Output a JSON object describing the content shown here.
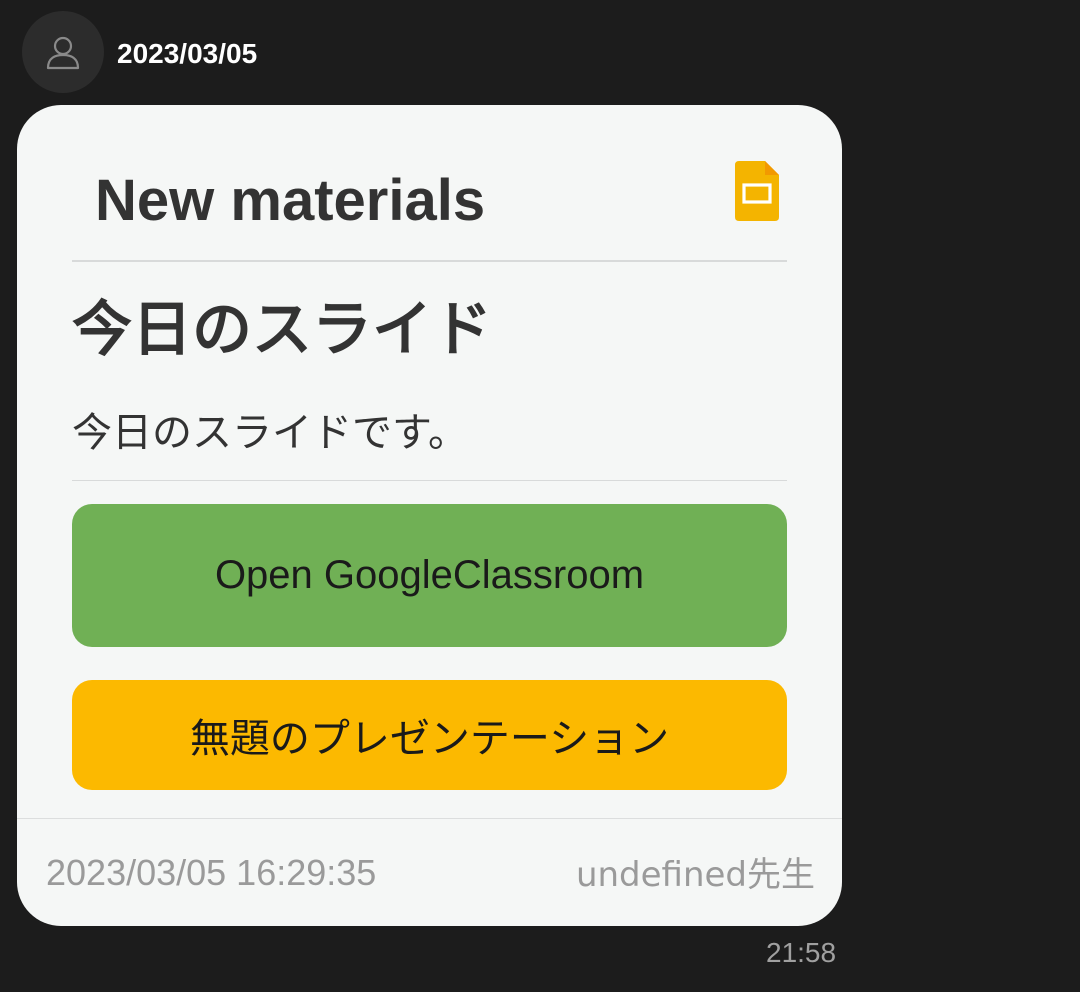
{
  "sender": {
    "name": "2023/03/05",
    "avatar_icon": "person-outline-icon"
  },
  "card": {
    "header_title": "New materials",
    "header_icon": "google-slides-icon",
    "material_title": "今日のスライド",
    "material_description": "今日のスライドです。",
    "buttons": [
      {
        "label": "Open GoogleClassroom",
        "color": "#70b055"
      },
      {
        "label": "無題のプレゼンテーション",
        "color": "#fcb900"
      }
    ],
    "footer": {
      "datetime": "2023/03/05 16:29:35",
      "author": "undefined先生"
    }
  },
  "message_time": "21:58",
  "colors": {
    "background": "#1c1c1c",
    "bubble": "#f5f7f6",
    "slides_icon": "#f4b400"
  }
}
